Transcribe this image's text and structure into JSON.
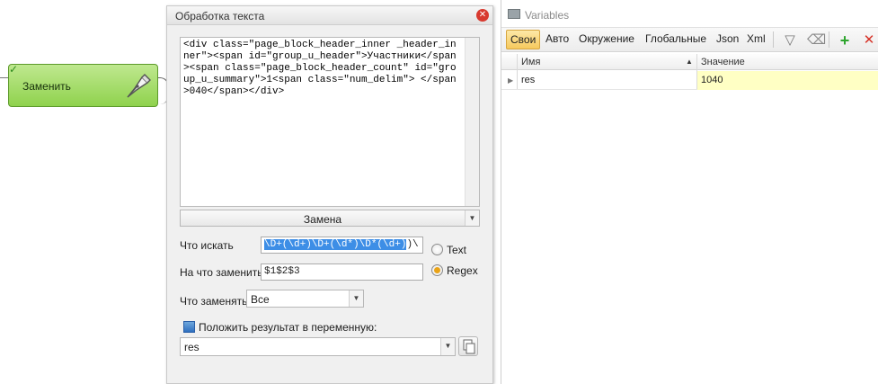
{
  "node": {
    "title": "Заменить",
    "icon": "pen-nib-icon"
  },
  "dialog": {
    "title": "Обработка текста",
    "code_text": "<div class=\"page_block_header_inner _header_inner\"><span id=\"group_u_header\">Участники</span><span class=\"page_block_header_count\" id=\"group_u_summary\">1<span class=\"num_delim\"> </span>040</span></div>",
    "mode_value": "Замена",
    "search_label": "Что искать",
    "search_value": "\\D+(\\d+)\\D+(\\d*)\\D*(\\d+)\\",
    "search_selected": "\\D+(\\d+)\\D+(\\d*)\\D*(\\d+)",
    "search_tail": ")\\",
    "replace_label": "На что заменить",
    "replace_value": "$1$2$3",
    "radio_text": "Text",
    "radio_regex": "Regex",
    "radio_selected": "Regex",
    "what_replace_label": "Что заменять",
    "what_replace_value": "Все",
    "save_to_var_label": "Положить результат в переменную:",
    "result_var_value": "res"
  },
  "variables": {
    "title": "Variables",
    "tabs": [
      "Свои",
      "Авто",
      "Окружение",
      "Глобальные",
      "Json",
      "Xml"
    ],
    "active_tab": "Свои",
    "col_name": "Имя",
    "col_value": "Значение",
    "rows": [
      {
        "name": "res",
        "value": "1040"
      }
    ]
  },
  "colors": {
    "node_green": "#8fd24d",
    "active_tab": "#f6c95d",
    "selection": "#3d8ee6",
    "value_cell": "#ffffc4",
    "close": "#d83a2f"
  }
}
